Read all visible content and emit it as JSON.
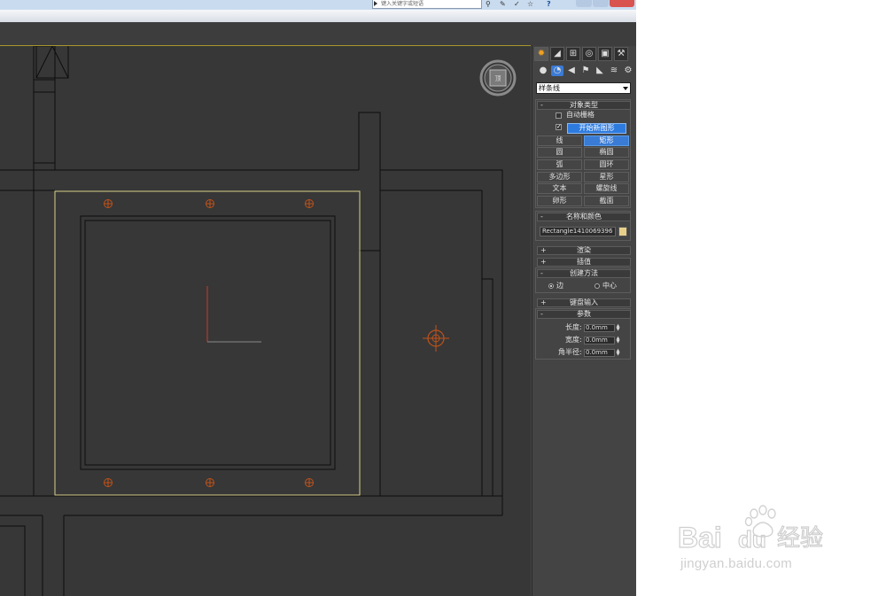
{
  "titlebar": {
    "search_placeholder": "键入关键字或短语",
    "icons": [
      "binoculars-icon",
      "tools-icon",
      "pin-icon",
      "star-icon",
      "help-icon"
    ],
    "help_glyph": "?",
    "window_controls": [
      "minimize",
      "maximize",
      "close"
    ]
  },
  "panel": {
    "tabs": [
      "create",
      "modify",
      "hierarchy",
      "motion",
      "display",
      "utilities"
    ],
    "subcategories": [
      "geometry",
      "shapes",
      "lights",
      "cameras",
      "helpers",
      "space-warps",
      "systems"
    ],
    "dropdown_value": "样条线",
    "object_type": {
      "header": "对象类型",
      "auto_grid": "自动栅格",
      "start_new_shape": "开始新图形",
      "start_new_checked": "✓",
      "buttons": [
        {
          "label": "线",
          "active": false
        },
        {
          "label": "矩形",
          "active": true
        },
        {
          "label": "圆",
          "active": false
        },
        {
          "label": "椭圆",
          "active": false
        },
        {
          "label": "弧",
          "active": false
        },
        {
          "label": "圆环",
          "active": false
        },
        {
          "label": "多边形",
          "active": false
        },
        {
          "label": "星形",
          "active": false
        },
        {
          "label": "文本",
          "active": false
        },
        {
          "label": "螺旋线",
          "active": false
        },
        {
          "label": "卵形",
          "active": false
        },
        {
          "label": "截面",
          "active": false
        }
      ]
    },
    "name_color": {
      "header": "名称和颜色",
      "name": "Rectangle1410069396",
      "color": "#e8d08a"
    },
    "rollouts": {
      "render": "渲染",
      "interpolation": "插值",
      "creation_method": "创建方法",
      "edge": "边",
      "center": "中心",
      "keyboard_entry": "键盘输入",
      "parameters": "参数"
    },
    "signs": {
      "plus": "+",
      "minus": "-"
    },
    "params": [
      {
        "label": "长度:",
        "value": "0.0mm"
      },
      {
        "label": "宽度:",
        "value": "0.0mm"
      },
      {
        "label": "角半径:",
        "value": "0.0mm"
      }
    ]
  },
  "viewport": {
    "border_color": "#a8952e",
    "selection_color": "#d9d08a",
    "snap_marker_color": "#c0521a"
  },
  "watermark": {
    "brand": "Bai du 经验",
    "url": "jingyan.baidu.com"
  }
}
